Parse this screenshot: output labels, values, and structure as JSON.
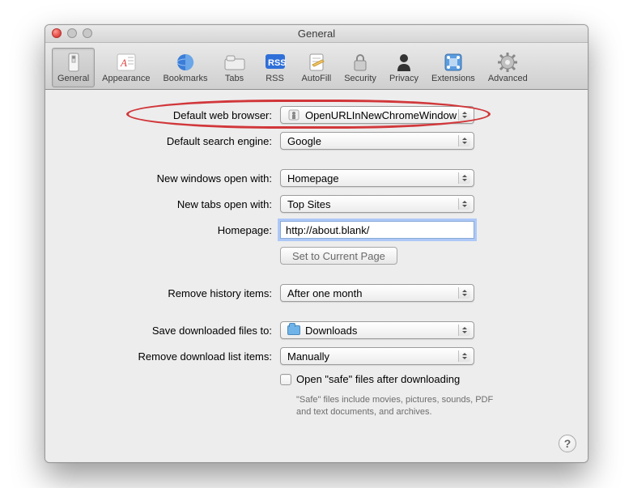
{
  "window": {
    "title": "General"
  },
  "toolbar": {
    "items": [
      {
        "label": "General"
      },
      {
        "label": "Appearance"
      },
      {
        "label": "Bookmarks"
      },
      {
        "label": "Tabs"
      },
      {
        "label": "RSS"
      },
      {
        "label": "AutoFill"
      },
      {
        "label": "Security"
      },
      {
        "label": "Privacy"
      },
      {
        "label": "Extensions"
      },
      {
        "label": "Advanced"
      }
    ]
  },
  "labels": {
    "default_browser": "Default web browser:",
    "default_search": "Default search engine:",
    "new_windows": "New windows open with:",
    "new_tabs": "New tabs open with:",
    "homepage": "Homepage:",
    "remove_history": "Remove history items:",
    "save_downloads": "Save downloaded files to:",
    "remove_downloads": "Remove download list items:"
  },
  "values": {
    "default_browser": "OpenURLInNewChromeWindow",
    "default_search": "Google",
    "new_windows": "Homepage",
    "new_tabs": "Top Sites",
    "homepage": "http://about.blank/",
    "remove_history": "After one month",
    "save_downloads": "Downloads",
    "remove_downloads": "Manually"
  },
  "buttons": {
    "set_current": "Set to Current Page"
  },
  "safe_files": {
    "label": "Open \"safe\" files after downloading",
    "note": "\"Safe\" files include movies, pictures, sounds, PDF and text documents, and archives."
  },
  "help": "?"
}
